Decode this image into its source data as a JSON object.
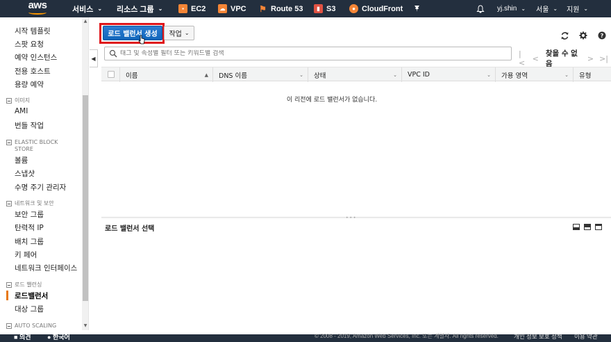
{
  "topnav": {
    "logo_text": "aws",
    "services_label": "서비스",
    "resource_groups_label": "리소스 그룹",
    "services": [
      {
        "label": "EC2",
        "color": "#f58536"
      },
      {
        "label": "VPC",
        "color": "#f58536"
      },
      {
        "label": "Route 53",
        "color": "#f58536"
      },
      {
        "label": "S3",
        "color": "#e05243"
      },
      {
        "label": "CloudFront",
        "color": "#f58536"
      }
    ],
    "user": "yj.shin",
    "region": "서울",
    "support": "지원"
  },
  "sidebar": {
    "items_top": [
      "시작 템플릿",
      "스팟 요청",
      "예약 인스턴스",
      "전용 호스트",
      "용량 예약"
    ],
    "sections": [
      {
        "title": "이미지",
        "items": [
          "AMI",
          "번들 작업"
        ]
      },
      {
        "title": "ELASTIC BLOCK STORE",
        "items": [
          "볼륨",
          "스냅샷",
          "수명 주기 관리자"
        ]
      },
      {
        "title": "네트워크 및 보안",
        "items": [
          "보안 그룹",
          "탄력적 IP",
          "배치 그룹",
          "키 페어",
          "네트워크 인터페이스"
        ]
      },
      {
        "title": "로드 밸런싱",
        "items": [
          "로드밸런서",
          "대상 그룹"
        ]
      },
      {
        "title": "AUTO SCALING",
        "items": []
      }
    ],
    "active_item": "로드밸런서"
  },
  "toolbar": {
    "create_label": "로드 밸런서 생성",
    "actions_label": "작업"
  },
  "search": {
    "placeholder": "태그 및 속성별 필터 또는 키워드별 검색"
  },
  "pager": {
    "text": "찾을 수 없음"
  },
  "table": {
    "columns": [
      "이름",
      "DNS 이름",
      "상태",
      "VPC ID",
      "가용 영역",
      "유형"
    ],
    "empty_message": "이 리전에 로드 밸런서가 없습니다."
  },
  "lower_panel": {
    "title": "로드 밸런서 선택"
  },
  "footer": {
    "feedback": "의견",
    "language": "한국어",
    "copyright": "© 2008 - 2019, Amazon Web Services, Inc. 또는 계열사. All rights reserved.",
    "privacy": "개인 정보 보호 정책",
    "terms": "이용 약관"
  }
}
